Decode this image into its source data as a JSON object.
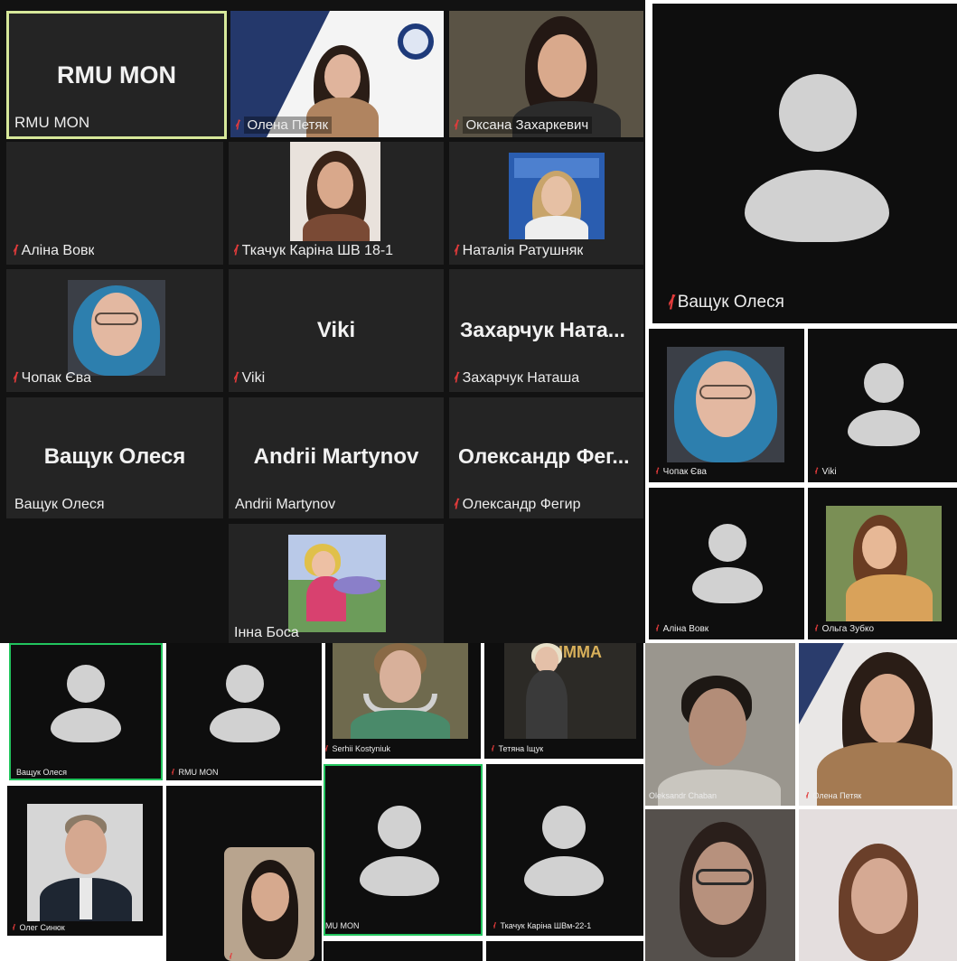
{
  "colors": {
    "mic_muted": "#e23b3b",
    "active_speaker": "#d7e89a",
    "speaking": "#22c55e"
  },
  "panel_a": {
    "tiles": [
      {
        "big": "RMU MON",
        "label": "RMU MON",
        "muted": false
      },
      {
        "label": "Олена Петяк",
        "muted": true
      },
      {
        "label": "Оксана Захаркевич",
        "muted": true
      },
      {
        "label": "Аліна Вовк",
        "muted": true
      },
      {
        "label": "Ткачук Каріна ШВ 18-1",
        "muted": true
      },
      {
        "label": "Наталія Ратушняк",
        "muted": true
      },
      {
        "label": "Чопак Єва",
        "muted": true
      },
      {
        "big": "Viki",
        "label": "Viki",
        "muted": true
      },
      {
        "big": "Захарчук Ната...",
        "label": "Захарчук Наташа",
        "muted": true
      },
      {
        "big": "Ващук Олеся",
        "label": "Ващук Олеся",
        "muted": false
      },
      {
        "big": "Andrii Martynov",
        "label": "Andrii Martynov",
        "muted": false
      },
      {
        "big": "Олександр Фег...",
        "label": "Олександр Фегир",
        "muted": true
      },
      {
        "label": "Інна Боса",
        "muted": false
      }
    ]
  },
  "panel_b": {
    "tiles": [
      {
        "label": "Ващук Олеся",
        "muted": true
      },
      {
        "label": "Чопак Єва",
        "muted": true
      },
      {
        "label": "Viki",
        "muted": true
      },
      {
        "label": "Аліна Вовк",
        "muted": true
      },
      {
        "label": "Ольга Зубко",
        "muted": true
      }
    ]
  },
  "panel_c": {
    "tiles": [
      {
        "label": "Ващук Олеся",
        "muted": false
      },
      {
        "label": "RMU MON",
        "muted": true
      },
      {
        "label": "Serhii Kostyniuk",
        "muted": true
      },
      {
        "label": "Тетяна Іщук",
        "muted": true
      },
      {
        "label": "Олег Синюк",
        "muted": true
      },
      {
        "label": "",
        "muted": true
      },
      {
        "label": "MU MON",
        "muted": false
      },
      {
        "label": "Ткачук Каріна ШВм-22-1",
        "muted": true
      }
    ]
  },
  "panel_d": {
    "tiles": [
      {
        "label": "Oleksandr Chaban",
        "muted": false
      },
      {
        "label": "Олена Петяк",
        "muted": true
      },
      {
        "label": "",
        "muted": false
      },
      {
        "label": "",
        "muted": false
      }
    ]
  }
}
